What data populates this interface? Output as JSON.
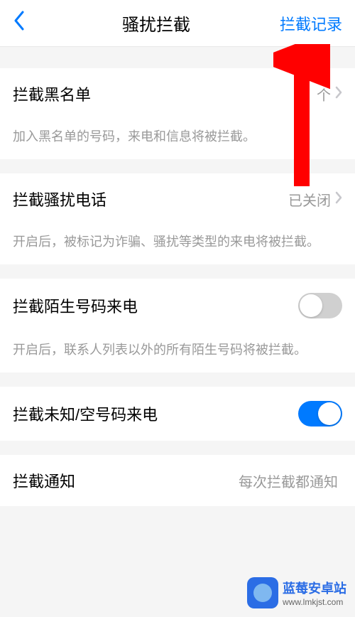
{
  "header": {
    "title": "骚扰拦截",
    "right_label": "拦截记录"
  },
  "rows": {
    "blacklist": {
      "title": "拦截黑名单",
      "value": "个",
      "desc": "加入黑名单的号码，来电和信息将被拦截。"
    },
    "spam_calls": {
      "title": "拦截骚扰电话",
      "value": "已关闭",
      "desc": "开启后，被标记为诈骗、骚扰等类型的来电将被拦截。"
    },
    "unknown_numbers": {
      "title": "拦截陌生号码来电",
      "desc": "开启后，联系人列表以外的所有陌生号码将被拦截。"
    },
    "empty_numbers": {
      "title": "拦截未知/空号码来电"
    },
    "notify": {
      "title": "拦截通知",
      "value": "每次拦截都通知"
    }
  },
  "watermark": {
    "line1": "蓝莓安卓站",
    "line2": "www.lmkjst.com"
  }
}
